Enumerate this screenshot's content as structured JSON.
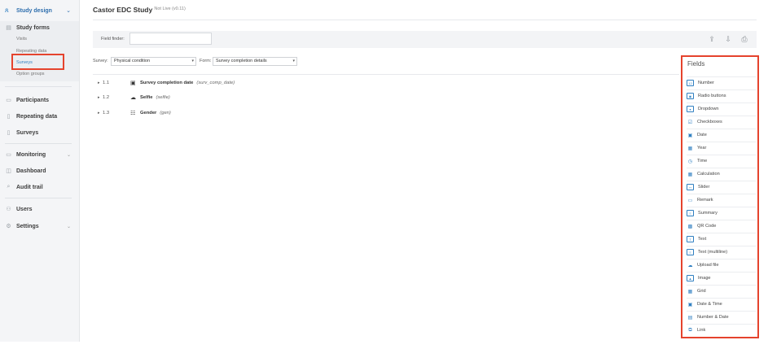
{
  "app": {
    "title": "Castor EDC Study",
    "status": "- Not Live (v0.11)"
  },
  "sidebar": {
    "study_design": "Study design",
    "study_forms": "Study forms",
    "sub_links": [
      "Visits",
      "Repeating data",
      "Surveys",
      "Option groups"
    ],
    "nav": [
      {
        "label": "Participants"
      },
      {
        "label": "Repeating data"
      },
      {
        "label": "Surveys"
      },
      {
        "label": "Monitoring"
      },
      {
        "label": "Dashboard"
      },
      {
        "label": "Audit trail"
      },
      {
        "label": "Users"
      },
      {
        "label": "Settings"
      }
    ]
  },
  "toolbar": {
    "field_finder_label": "Field finder:",
    "field_finder_value": ""
  },
  "selectors": {
    "survey_label": "Survey:",
    "survey_value": "Physical condition",
    "form_label": "Form:",
    "form_value": "Survey completion details"
  },
  "fields_list": [
    {
      "num": "1.1",
      "name": "Survey completion date",
      "var": "(surv_comp_date)"
    },
    {
      "num": "1.2",
      "name": "Selfie",
      "var": "(selfie)"
    },
    {
      "num": "1.3",
      "name": "Gender",
      "var": "(gen)"
    }
  ],
  "panel": {
    "title": "Fields",
    "items": [
      "Number",
      "Radio buttons",
      "Dropdown",
      "Checkboxes",
      "Date",
      "Year",
      "Time",
      "Calculation",
      "Slider",
      "Remark",
      "Summary",
      "QR Code",
      "Text",
      "Text (multiline)",
      "Upload file",
      "Image",
      "Grid",
      "Date & Time",
      "Number & Date",
      "Link"
    ]
  },
  "colors": {
    "accent": "#2f7fc1",
    "highlight": "#e5432d"
  }
}
